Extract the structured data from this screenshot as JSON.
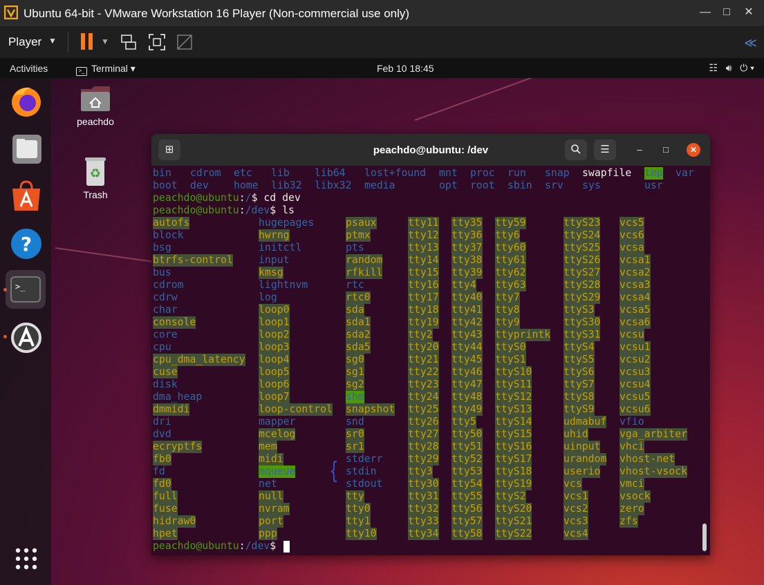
{
  "vm": {
    "title": "Ubuntu 64-bit - VMware Workstation 16 Player (Non-commercial use only)",
    "player_menu": "Player",
    "accent": "#ff7a1a"
  },
  "topbar": {
    "activities": "Activities",
    "app_menu": "Terminal",
    "clock": "Feb 10  18:45"
  },
  "desktop": {
    "icons": [
      {
        "label": "peachdo",
        "icon": "home-folder-icon"
      },
      {
        "label": "Trash",
        "icon": "trash-icon"
      }
    ]
  },
  "dock": [
    "firefox-icon",
    "files-icon",
    "software-icon",
    "help-icon",
    "terminal-icon",
    "updater-icon",
    "show-apps-icon"
  ],
  "terminal": {
    "title": "peachdo@ubuntu: /dev",
    "prompt_user": "peachdo@ubuntu",
    "root_listing": [
      [
        {
          "t": "bin",
          "c": "blue"
        },
        {
          "t": "cdrom",
          "c": "blue"
        },
        {
          "t": "etc",
          "c": "blue"
        },
        {
          "t": "lib",
          "c": "blue"
        },
        {
          "t": "lib64",
          "c": "blue"
        },
        {
          "t": "lost+found",
          "c": "blue"
        },
        {
          "t": "mnt",
          "c": "blue"
        },
        {
          "t": "proc",
          "c": "blue"
        },
        {
          "t": "run",
          "c": "blue"
        },
        {
          "t": "snap",
          "c": "blue"
        },
        {
          "t": "swapfile",
          "c": "white"
        },
        {
          "t": "tmp",
          "c": "hlg"
        },
        {
          "t": "var",
          "c": "blue"
        }
      ],
      [
        {
          "t": "boot",
          "c": "blue"
        },
        {
          "t": "dev",
          "c": "blue"
        },
        {
          "t": "home",
          "c": "blue"
        },
        {
          "t": "lib32",
          "c": "blue"
        },
        {
          "t": "libx32",
          "c": "blue"
        },
        {
          "t": "media",
          "c": "blue"
        },
        {
          "t": "opt",
          "c": "blue"
        },
        {
          "t": "root",
          "c": "blue"
        },
        {
          "t": "sbin",
          "c": "blue"
        },
        {
          "t": "srv",
          "c": "blue"
        },
        {
          "t": "sys",
          "c": "blue"
        },
        {
          "t": "usr",
          "c": "blue"
        }
      ]
    ],
    "cmd1": {
      "path": "/",
      "cmd": "cd dev"
    },
    "cmd2": {
      "path": "/dev",
      "cmd": "ls"
    },
    "cmd3": {
      "path": "/dev",
      "cmd": ""
    },
    "dev_columns": [
      [
        {
          "t": "autofs",
          "c": "hl"
        },
        {
          "t": "block",
          "c": "blue"
        },
        {
          "t": "bsg",
          "c": "blue"
        },
        {
          "t": "btrfs-control",
          "c": "hl"
        },
        {
          "t": "bus",
          "c": "blue"
        },
        {
          "t": "cdrom",
          "c": "blue"
        },
        {
          "t": "cdrw",
          "c": "blue"
        },
        {
          "t": "char",
          "c": "blue"
        },
        {
          "t": "console",
          "c": "hl"
        },
        {
          "t": "core",
          "c": "blue"
        },
        {
          "t": "cpu",
          "c": "blue"
        },
        {
          "t": "cpu_dma_latency",
          "c": "hl"
        },
        {
          "t": "cuse",
          "c": "hl"
        },
        {
          "t": "disk",
          "c": "blue"
        },
        {
          "t": "dma_heap",
          "c": "blue"
        },
        {
          "t": "dmmidi",
          "c": "hl"
        },
        {
          "t": "dri",
          "c": "blue"
        },
        {
          "t": "dvd",
          "c": "blue"
        },
        {
          "t": "ecryptfs",
          "c": "hl"
        },
        {
          "t": "fb0",
          "c": "hl"
        },
        {
          "t": "fd",
          "c": "blue"
        },
        {
          "t": "fd0",
          "c": "hl"
        },
        {
          "t": "full",
          "c": "hl"
        },
        {
          "t": "fuse",
          "c": "hl"
        },
        {
          "t": "hidraw0",
          "c": "hl"
        },
        {
          "t": "hpet",
          "c": "hl"
        }
      ],
      [
        {
          "t": "hugepages",
          "c": "blue"
        },
        {
          "t": "hwrng",
          "c": "hl"
        },
        {
          "t": "initctl",
          "c": "blue"
        },
        {
          "t": "input",
          "c": "blue"
        },
        {
          "t": "kmsg",
          "c": "hl"
        },
        {
          "t": "lightnvm",
          "c": "blue"
        },
        {
          "t": "log",
          "c": "blue"
        },
        {
          "t": "loop0",
          "c": "hl"
        },
        {
          "t": "loop1",
          "c": "hl"
        },
        {
          "t": "loop2",
          "c": "hl"
        },
        {
          "t": "loop3",
          "c": "hl"
        },
        {
          "t": "loop4",
          "c": "hl"
        },
        {
          "t": "loop5",
          "c": "hl"
        },
        {
          "t": "loop6",
          "c": "hl"
        },
        {
          "t": "loop7",
          "c": "hl"
        },
        {
          "t": "loop-control",
          "c": "hl"
        },
        {
          "t": "mapper",
          "c": "blue"
        },
        {
          "t": "mcelog",
          "c": "hl"
        },
        {
          "t": "mem",
          "c": "hl"
        },
        {
          "t": "midi",
          "c": "hl"
        },
        {
          "t": "mqueue",
          "c": "hlg"
        },
        {
          "t": "net",
          "c": "blue"
        },
        {
          "t": "null",
          "c": "hl"
        },
        {
          "t": "nvram",
          "c": "hl"
        },
        {
          "t": "port",
          "c": "hl"
        },
        {
          "t": "ppp",
          "c": "hl"
        }
      ],
      [
        {
          "t": "psaux",
          "c": "hl"
        },
        {
          "t": "ptmx",
          "c": "hl"
        },
        {
          "t": "pts",
          "c": "blue"
        },
        {
          "t": "random",
          "c": "hl"
        },
        {
          "t": "rfkill",
          "c": "hl"
        },
        {
          "t": "rtc",
          "c": "blue"
        },
        {
          "t": "rtc0",
          "c": "hl"
        },
        {
          "t": "sda",
          "c": "hl"
        },
        {
          "t": "sda1",
          "c": "hl"
        },
        {
          "t": "sda2",
          "c": "hl"
        },
        {
          "t": "sda5",
          "c": "hl"
        },
        {
          "t": "sg0",
          "c": "hl"
        },
        {
          "t": "sg1",
          "c": "hl"
        },
        {
          "t": "sg2",
          "c": "hl"
        },
        {
          "t": "shm",
          "c": "hlg"
        },
        {
          "t": "snapshot",
          "c": "hl"
        },
        {
          "t": "snd",
          "c": "blue"
        },
        {
          "t": "sr0",
          "c": "hl"
        },
        {
          "t": "sr1",
          "c": "hl"
        },
        {
          "t": "stderr",
          "c": "blue"
        },
        {
          "t": "stdin",
          "c": "blue"
        },
        {
          "t": "stdout",
          "c": "blue"
        },
        {
          "t": "tty",
          "c": "hl"
        },
        {
          "t": "tty0",
          "c": "hl"
        },
        {
          "t": "tty1",
          "c": "hl"
        },
        {
          "t": "tty10",
          "c": "hl"
        }
      ],
      [
        {
          "t": "tty11",
          "c": "hl"
        },
        {
          "t": "tty12",
          "c": "hl"
        },
        {
          "t": "tty13",
          "c": "hl"
        },
        {
          "t": "tty14",
          "c": "hl"
        },
        {
          "t": "tty15",
          "c": "hl"
        },
        {
          "t": "tty16",
          "c": "hl"
        },
        {
          "t": "tty17",
          "c": "hl"
        },
        {
          "t": "tty18",
          "c": "hl"
        },
        {
          "t": "tty19",
          "c": "hl"
        },
        {
          "t": "tty2",
          "c": "hl"
        },
        {
          "t": "tty20",
          "c": "hl"
        },
        {
          "t": "tty21",
          "c": "hl"
        },
        {
          "t": "tty22",
          "c": "hl"
        },
        {
          "t": "tty23",
          "c": "hl"
        },
        {
          "t": "tty24",
          "c": "hl"
        },
        {
          "t": "tty25",
          "c": "hl"
        },
        {
          "t": "tty26",
          "c": "hl"
        },
        {
          "t": "tty27",
          "c": "hl"
        },
        {
          "t": "tty28",
          "c": "hl"
        },
        {
          "t": "tty29",
          "c": "hl"
        },
        {
          "t": "tty3",
          "c": "hl"
        },
        {
          "t": "tty30",
          "c": "hl"
        },
        {
          "t": "tty31",
          "c": "hl"
        },
        {
          "t": "tty32",
          "c": "hl"
        },
        {
          "t": "tty33",
          "c": "hl"
        },
        {
          "t": "tty34",
          "c": "hl"
        }
      ],
      [
        {
          "t": "tty35",
          "c": "hl"
        },
        {
          "t": "tty36",
          "c": "hl"
        },
        {
          "t": "tty37",
          "c": "hl"
        },
        {
          "t": "tty38",
          "c": "hl"
        },
        {
          "t": "tty39",
          "c": "hl"
        },
        {
          "t": "tty4",
          "c": "hl"
        },
        {
          "t": "tty40",
          "c": "hl"
        },
        {
          "t": "tty41",
          "c": "hl"
        },
        {
          "t": "tty42",
          "c": "hl"
        },
        {
          "t": "tty43",
          "c": "hl"
        },
        {
          "t": "tty44",
          "c": "hl"
        },
        {
          "t": "tty45",
          "c": "hl"
        },
        {
          "t": "tty46",
          "c": "hl"
        },
        {
          "t": "tty47",
          "c": "hl"
        },
        {
          "t": "tty48",
          "c": "hl"
        },
        {
          "t": "tty49",
          "c": "hl"
        },
        {
          "t": "tty5",
          "c": "hl"
        },
        {
          "t": "tty50",
          "c": "hl"
        },
        {
          "t": "tty51",
          "c": "hl"
        },
        {
          "t": "tty52",
          "c": "hl"
        },
        {
          "t": "tty53",
          "c": "hl"
        },
        {
          "t": "tty54",
          "c": "hl"
        },
        {
          "t": "tty55",
          "c": "hl"
        },
        {
          "t": "tty56",
          "c": "hl"
        },
        {
          "t": "tty57",
          "c": "hl"
        },
        {
          "t": "tty58",
          "c": "hl"
        }
      ],
      [
        {
          "t": "tty59",
          "c": "hl"
        },
        {
          "t": "tty6",
          "c": "hl"
        },
        {
          "t": "tty60",
          "c": "hl"
        },
        {
          "t": "tty61",
          "c": "hl"
        },
        {
          "t": "tty62",
          "c": "hl"
        },
        {
          "t": "tty63",
          "c": "hl"
        },
        {
          "t": "tty7",
          "c": "hl"
        },
        {
          "t": "tty8",
          "c": "hl"
        },
        {
          "t": "tty9",
          "c": "hl"
        },
        {
          "t": "ttyprintk",
          "c": "hl"
        },
        {
          "t": "ttyS0",
          "c": "hl"
        },
        {
          "t": "ttyS1",
          "c": "hl"
        },
        {
          "t": "ttyS10",
          "c": "hl"
        },
        {
          "t": "ttyS11",
          "c": "hl"
        },
        {
          "t": "ttyS12",
          "c": "hl"
        },
        {
          "t": "ttyS13",
          "c": "hl"
        },
        {
          "t": "ttyS14",
          "c": "hl"
        },
        {
          "t": "ttyS15",
          "c": "hl"
        },
        {
          "t": "ttyS16",
          "c": "hl"
        },
        {
          "t": "ttyS17",
          "c": "hl"
        },
        {
          "t": "ttyS18",
          "c": "hl"
        },
        {
          "t": "ttyS19",
          "c": "hl"
        },
        {
          "t": "ttyS2",
          "c": "hl"
        },
        {
          "t": "ttyS20",
          "c": "hl"
        },
        {
          "t": "ttyS21",
          "c": "hl"
        },
        {
          "t": "ttyS22",
          "c": "hl"
        }
      ],
      [
        {
          "t": "ttyS23",
          "c": "hl"
        },
        {
          "t": "ttyS24",
          "c": "hl"
        },
        {
          "t": "ttyS25",
          "c": "hl"
        },
        {
          "t": "ttyS26",
          "c": "hl"
        },
        {
          "t": "ttyS27",
          "c": "hl"
        },
        {
          "t": "ttyS28",
          "c": "hl"
        },
        {
          "t": "ttyS29",
          "c": "hl"
        },
        {
          "t": "ttyS3",
          "c": "hl"
        },
        {
          "t": "ttyS30",
          "c": "hl"
        },
        {
          "t": "ttyS31",
          "c": "hl"
        },
        {
          "t": "ttyS4",
          "c": "hl"
        },
        {
          "t": "ttyS5",
          "c": "hl"
        },
        {
          "t": "ttyS6",
          "c": "hl"
        },
        {
          "t": "ttyS7",
          "c": "hl"
        },
        {
          "t": "ttyS8",
          "c": "hl"
        },
        {
          "t": "ttyS9",
          "c": "hl"
        },
        {
          "t": "udmabuf",
          "c": "hl"
        },
        {
          "t": "uhid",
          "c": "hl"
        },
        {
          "t": "uinput",
          "c": "hl"
        },
        {
          "t": "urandom",
          "c": "hl"
        },
        {
          "t": "userio",
          "c": "hl"
        },
        {
          "t": "vcs",
          "c": "hl"
        },
        {
          "t": "vcs1",
          "c": "hl"
        },
        {
          "t": "vcs2",
          "c": "hl"
        },
        {
          "t": "vcs3",
          "c": "hl"
        },
        {
          "t": "vcs4",
          "c": "hl"
        }
      ],
      [
        {
          "t": "vcs5",
          "c": "hl"
        },
        {
          "t": "vcs6",
          "c": "hl"
        },
        {
          "t": "vcsa",
          "c": "hl"
        },
        {
          "t": "vcsa1",
          "c": "hl"
        },
        {
          "t": "vcsa2",
          "c": "hl"
        },
        {
          "t": "vcsa3",
          "c": "hl"
        },
        {
          "t": "vcsa4",
          "c": "hl"
        },
        {
          "t": "vcsa5",
          "c": "hl"
        },
        {
          "t": "vcsa6",
          "c": "hl"
        },
        {
          "t": "vcsu",
          "c": "hl"
        },
        {
          "t": "vcsu1",
          "c": "hl"
        },
        {
          "t": "vcsu2",
          "c": "hl"
        },
        {
          "t": "vcsu3",
          "c": "hl"
        },
        {
          "t": "vcsu4",
          "c": "hl"
        },
        {
          "t": "vcsu5",
          "c": "hl"
        },
        {
          "t": "vcsu6",
          "c": "hl"
        },
        {
          "t": "vfio",
          "c": "blue"
        },
        {
          "t": "vga_arbiter",
          "c": "hl"
        },
        {
          "t": "vhci",
          "c": "hl"
        },
        {
          "t": "vhost-net",
          "c": "hl"
        },
        {
          "t": "vhost-vsock",
          "c": "hl"
        },
        {
          "t": "vmci",
          "c": "hl"
        },
        {
          "t": "vsock",
          "c": "hl"
        },
        {
          "t": "zero",
          "c": "hl"
        },
        {
          "t": "zfs",
          "c": "hl"
        }
      ]
    ]
  }
}
